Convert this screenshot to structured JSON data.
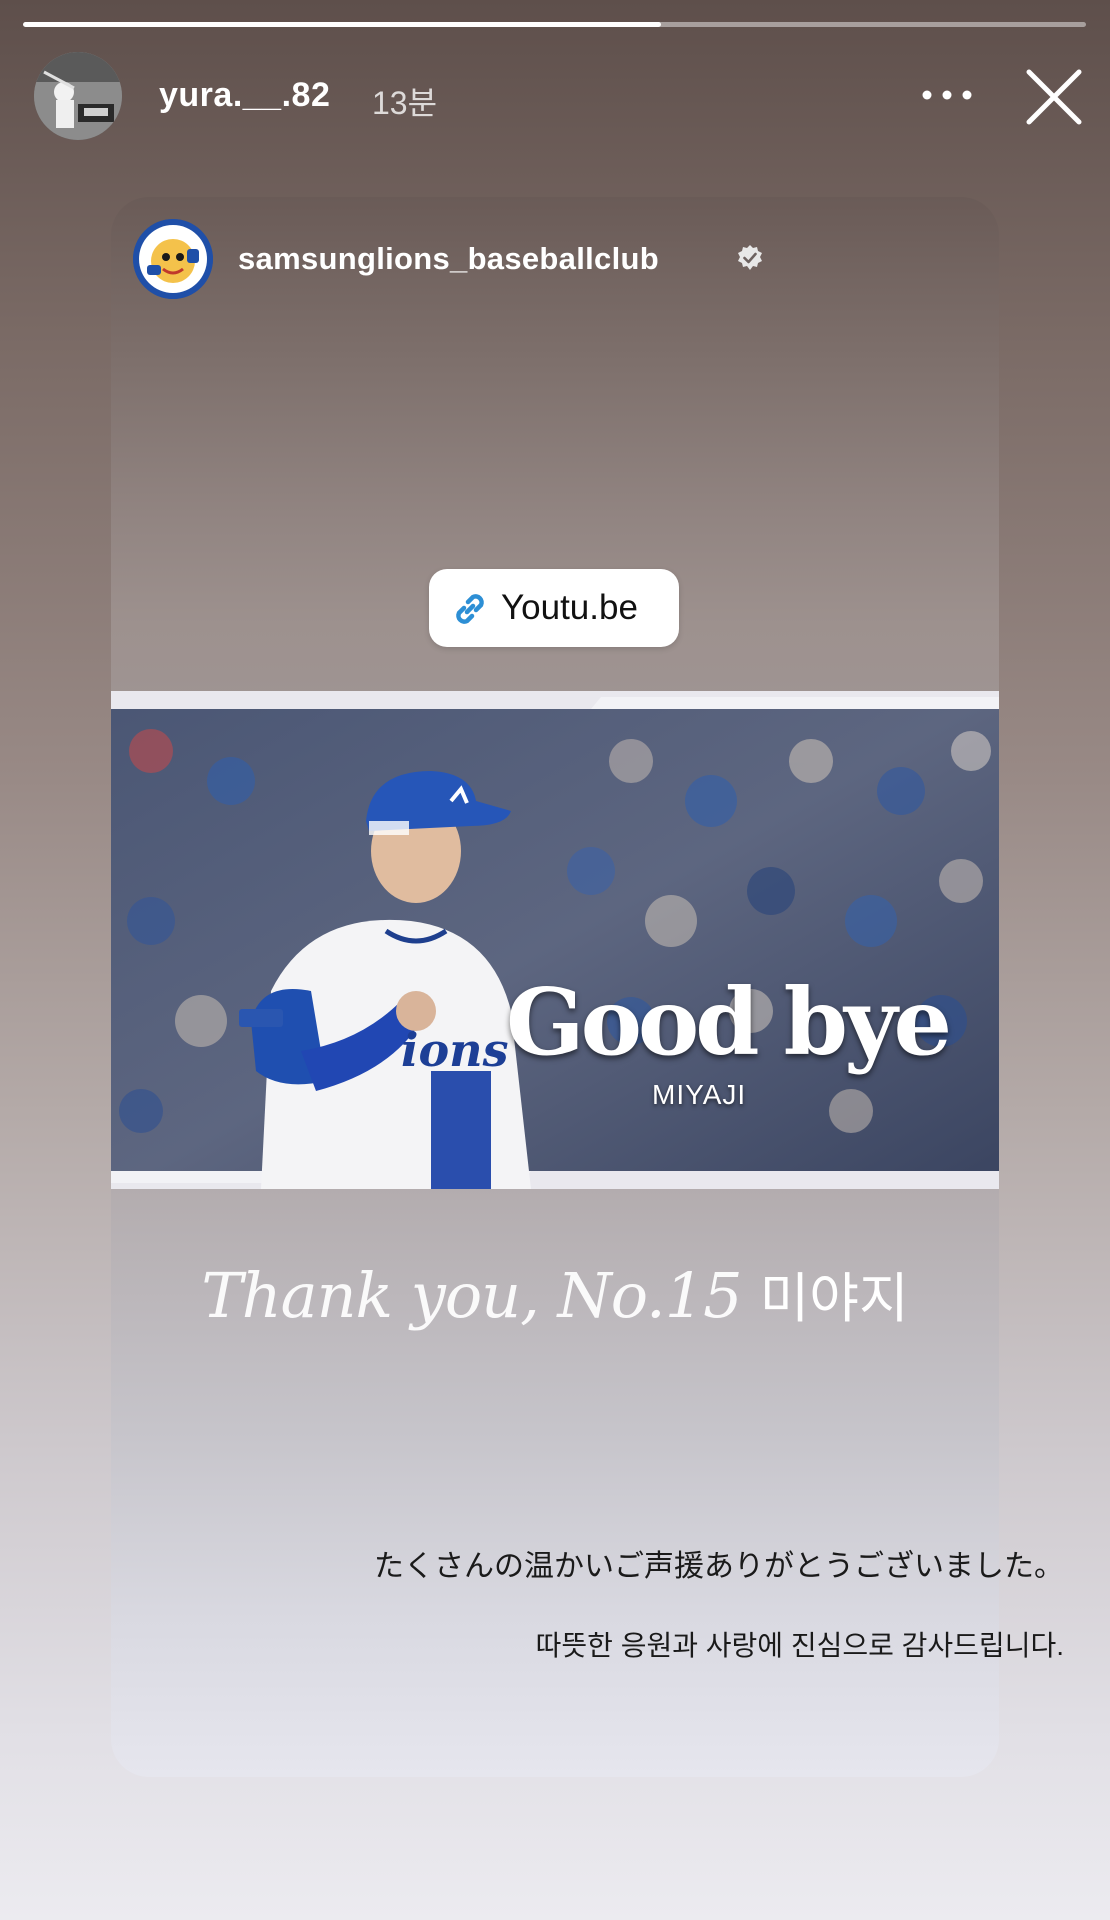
{
  "story": {
    "progress_fraction": 0.6,
    "username": "yura.__.82",
    "timestamp": "13분",
    "more_icon": "more-horizontal-icon",
    "close_icon": "close-icon"
  },
  "shared_post": {
    "account_name": "samsunglions_baseballclub",
    "verified_icon": "verified-badge-icon",
    "link_sticker": {
      "label": "Youtu.be",
      "icon": "link-icon",
      "icon_color": "#2d8fd5"
    },
    "thumbnail": {
      "title": "Good bye",
      "subtitle": "MIYAJI"
    },
    "thanks_text_script": "Thank you, No.15",
    "thanks_text_korean": "미야지"
  },
  "captions": {
    "japanese": "たくさんの温かいご声援ありがとうございました。",
    "korean": "따뜻한 응원과 사랑에 진심으로 감사드립니다."
  },
  "colors": {
    "team_blue": "#1f4fa8",
    "text_light": "#ffffff",
    "caption_dark": "#1a1a1a"
  }
}
